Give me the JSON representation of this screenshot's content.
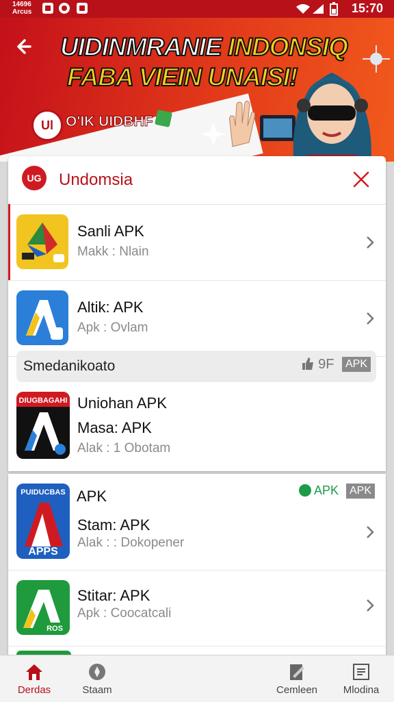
{
  "status_bar": {
    "left_line1": "14696",
    "left_line2": "Arcus",
    "time": "15:70"
  },
  "banner": {
    "title_white": "UIDINMRANIE",
    "title_yellow": "INDONSIQ",
    "title_line2": "FABA VIEIN UNAISI!",
    "logo_text": "Ul",
    "brand": "O'IK UIDBHF"
  },
  "sheet": {
    "header_logo": "UG",
    "header_title": "Undomsia"
  },
  "apps_top": [
    {
      "name": "Sanli  APK",
      "sub": "Makk : Nlain"
    },
    {
      "name": "Altik: APK",
      "sub": "Apk : Ovlam"
    }
  ],
  "section": {
    "label": "Smedanikoato",
    "right_text": "9F",
    "badge": "APK"
  },
  "app3": {
    "icon_text": "DIUGBAGAHI",
    "name": "Uniohan APK",
    "name2": "Masa: APK",
    "sub": "Alak : 1 Obotam"
  },
  "card2": {
    "tagline": "APK",
    "badge_green": "APK",
    "badge_grey": "APK",
    "apps": [
      {
        "icon_top": "PUIDUCBAS",
        "icon_bottom": "APPS",
        "name": "Stam: APK",
        "sub": "Alak : : Dokopener"
      },
      {
        "icon_bottom": "ROS",
        "name": "Stitar: APK",
        "sub": "Apk : Coocatcali"
      }
    ]
  },
  "nav": {
    "items": [
      "Derdas",
      "Staam",
      "Cemleen",
      "Mlodina"
    ]
  },
  "colors": {
    "brand_red": "#b8111a",
    "accent_yellow": "#f7d21d",
    "green": "#1d9b4a"
  }
}
